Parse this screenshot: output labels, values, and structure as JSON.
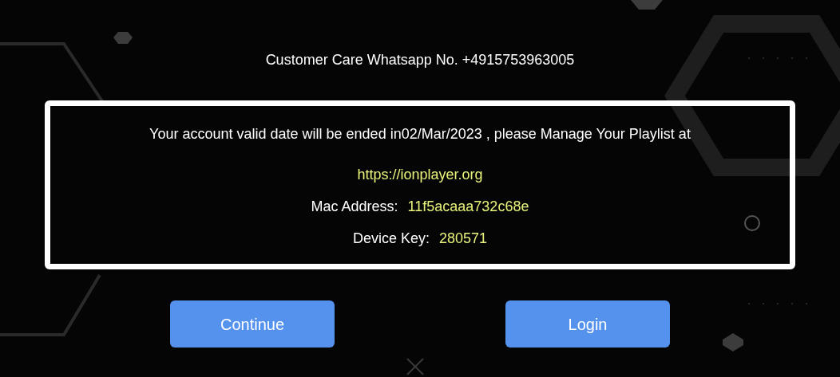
{
  "contact": {
    "text": "Customer Care Whatsapp No. +4915753963005"
  },
  "notice": {
    "message": "Your account valid date will be ended in02/Mar/2023 , please Manage Your Playlist at",
    "url": "https://ionplayer.org",
    "fields": [
      {
        "label": "Mac Address:",
        "value": "11f5acaaa732c68e"
      },
      {
        "label": "Device Key:",
        "value": "280571"
      }
    ]
  },
  "buttons": [
    {
      "label": "Continue"
    },
    {
      "label": "Login"
    }
  ]
}
